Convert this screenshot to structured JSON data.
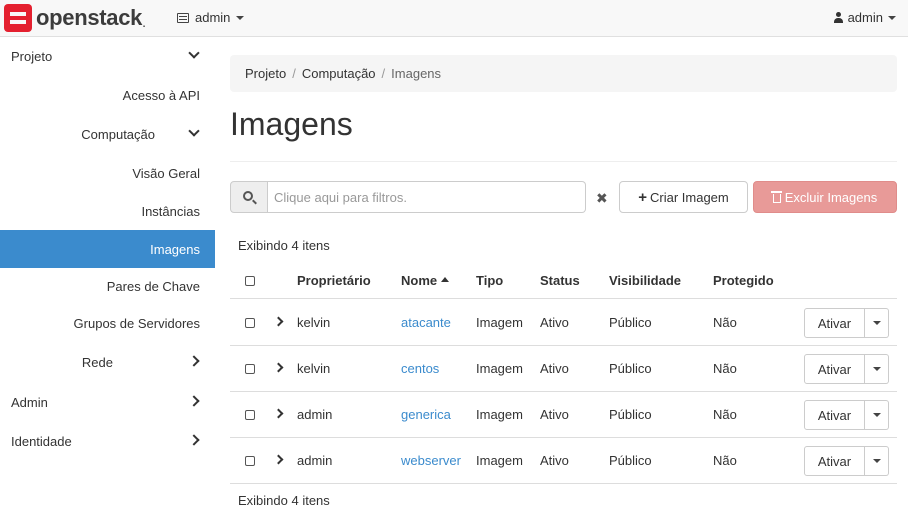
{
  "brand": {
    "name": "openstack",
    "dot": "."
  },
  "navbar": {
    "project": "admin",
    "user": "admin"
  },
  "sidebar": {
    "projeto": "Projeto",
    "acesso_api": "Acesso à API",
    "computacao": "Computação",
    "visao_geral": "Visão Geral",
    "instancias": "Instâncias",
    "imagens": "Imagens",
    "pares_chave": "Pares de Chave",
    "grupos_servidores": "Grupos de Servidores",
    "rede": "Rede",
    "admin": "Admin",
    "identidade": "Identidade"
  },
  "breadcrumb": [
    "Projeto",
    "Computação",
    "Imagens"
  ],
  "page": {
    "title": "Imagens"
  },
  "search": {
    "placeholder": "Clique aqui para filtros.",
    "clear": "✖"
  },
  "actions": {
    "create": "Criar Imagem",
    "delete": "Excluir Imagens"
  },
  "table": {
    "count_label": "Exibindo 4 itens",
    "headers": {
      "owner": "Proprietário",
      "name": "Nome",
      "type": "Tipo",
      "status": "Status",
      "visibility": "Visibilidade",
      "protected": "Protegido"
    },
    "rows": [
      {
        "owner": "kelvin",
        "name": "atacante",
        "type": "Imagem",
        "status": "Ativo",
        "visibility": "Público",
        "protected": "Não",
        "action": "Ativar"
      },
      {
        "owner": "kelvin",
        "name": "centos",
        "type": "Imagem",
        "status": "Ativo",
        "visibility": "Público",
        "protected": "Não",
        "action": "Ativar"
      },
      {
        "owner": "admin",
        "name": "generica",
        "type": "Imagem",
        "status": "Ativo",
        "visibility": "Público",
        "protected": "Não",
        "action": "Ativar"
      },
      {
        "owner": "admin",
        "name": "webserver",
        "type": "Imagem",
        "status": "Ativo",
        "visibility": "Público",
        "protected": "Não",
        "action": "Ativar"
      }
    ]
  },
  "colors": {
    "accent": "#3b8bcd",
    "danger": "#e89a98",
    "brand_red": "#e4202f"
  }
}
